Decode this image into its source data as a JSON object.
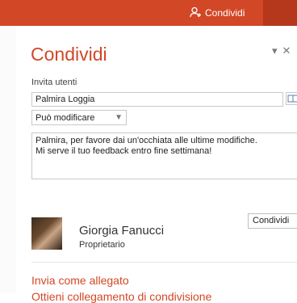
{
  "topbar": {
    "share_label": "Condividi"
  },
  "pane": {
    "title": "Condividi",
    "invite_label": "Invita utenti",
    "invite_value": "Palmira Loggia",
    "permission": "Può modificare",
    "message": "Palmira, per favore dai un'occhiata alle ultime modifiche.\nMi serve il tuo feedback entro fine settimana!",
    "send_button": "Condividi",
    "owner": {
      "name": "Giorgia Fanucci",
      "role": "Proprietario"
    },
    "links": {
      "attachment": "Invia come allegato",
      "get_link": "Ottieni collegamento di condivisione"
    }
  },
  "colors": {
    "accent": "#d24726"
  }
}
